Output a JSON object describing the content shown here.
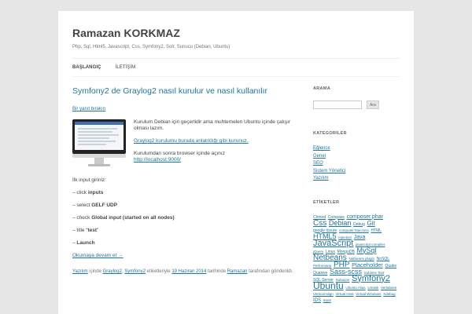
{
  "site": {
    "title": "Ramazan KORKMAZ",
    "description": "Php, Sql, Html5, Javascript, Css, Symfony2, Solr, Sunucu (Debian, Ubuntu)"
  },
  "nav": {
    "items": [
      {
        "label": "BAŞLANGIÇ"
      },
      {
        "label": "İLETİŞİM"
      }
    ]
  },
  "post": {
    "title": "Symfony2 de Graylog2 nasıl kurulur ve nasıl kullanılır",
    "comments_link": "Bir yanıt bırakın",
    "media_text": {
      "p1": "Kurulum Debian için geçerlidir ama muhtemelen Ubuntu içinde çalışır olması lazım.",
      "link": "Graylog2 kurulumu burada anlatıldığı gibi kurunuz.",
      "p3": "Kurulumdan sonra browser içinde açınız",
      "url": "http://localhost:9000/"
    },
    "body": {
      "intro": "İlk input giriniz:",
      "s1_prefix": "– click ",
      "s1_bold": "inputs",
      "s2_prefix": "– select ",
      "s2_bold": "GELF UDP",
      "s3_prefix": "– check ",
      "s3_bold": "Global input (started on all nodes)",
      "s4_prefix": "– title “",
      "s4_bold": "test",
      "s4_suffix": "”",
      "s5_prefix": "– ",
      "s5_bold": "Launch",
      "more": "Okumaya devam et →"
    },
    "meta": {
      "cat1": "Yazılım",
      "t1": " içinde ",
      "tag1": "Graylog2",
      "t2": ", ",
      "tag2": "Symfony2",
      "t3": " etiketleriyle ",
      "date": "19 Haziran 2014",
      "t4": " tarihinde ",
      "author": "Ramazan",
      "t5": " tarafından gönderildi."
    }
  },
  "sidebar": {
    "search": {
      "title": "ARAMA",
      "button": "Ara",
      "value": ""
    },
    "categories": {
      "title": "KATEGORİLER",
      "items": [
        {
          "label": "Eğlence"
        },
        {
          "label": "Genel"
        },
        {
          "label": "SEO"
        },
        {
          "label": "Sistem Yönetici"
        },
        {
          "label": "Yazılım"
        }
      ]
    },
    "tags": {
      "title": "ETİKETLER",
      "items": [
        {
          "label": "Chmod",
          "size": 5
        },
        {
          "label": "Compass",
          "size": 5
        },
        {
          "label": "composer.phar",
          "size": 7
        },
        {
          "label": "Css",
          "size": 10
        },
        {
          "label": "Debian",
          "size": 9
        },
        {
          "label": "Debug",
          "size": 5
        },
        {
          "label": "Git",
          "size": 8
        },
        {
          "label": "google tüsure",
          "size": 5
        },
        {
          "label": "computer htaccess",
          "size": 4.5
        },
        {
          "label": "HTML",
          "size": 5
        },
        {
          "label": "HTML5",
          "size": 9
        },
        {
          "label": "Injection",
          "size": 4.5
        },
        {
          "label": "Java",
          "size": 7
        },
        {
          "label": "JavaScript",
          "size": 11
        },
        {
          "label": "javascript compiler",
          "size": 4.5
        },
        {
          "label": "jQuery",
          "size": 4.5
        },
        {
          "label": "Linux",
          "size": 5
        },
        {
          "label": "MongoDB",
          "size": 5
        },
        {
          "label": "MySql",
          "size": 9
        },
        {
          "label": "Netbeans",
          "size": 10
        },
        {
          "label": "Netbeans plugin",
          "size": 4.5
        },
        {
          "label": "NoSQL",
          "size": 5
        },
        {
          "label": "Performans",
          "size": 4.5
        },
        {
          "label": "PHP",
          "size": 10
        },
        {
          "label": "Placeholder",
          "size": 7.5
        },
        {
          "label": "Quake",
          "size": 5
        },
        {
          "label": "Quakive",
          "size": 5
        },
        {
          "label": "Sass-scss",
          "size": 9
        },
        {
          "label": "Sublime Text",
          "size": 4.5
        },
        {
          "label": "SQL Server",
          "size": 5
        },
        {
          "label": "Subuşım",
          "size": 4.5
        },
        {
          "label": "Symfony2",
          "size": 11
        },
        {
          "label": "Ubuntu",
          "size": 12
        },
        {
          "label": "Ubuntu Alias",
          "size": 4.5
        },
        {
          "label": "Umask",
          "size": 4.5
        },
        {
          "label": "Vertabase",
          "size": 4.5
        },
        {
          "label": "Vertical-align",
          "size": 4.5
        },
        {
          "label": "Virtual Host",
          "size": 4.5
        },
        {
          "label": "Virtual Windows",
          "size": 4.5
        },
        {
          "label": "Xdebug",
          "size": 4.5
        },
        {
          "label": "IDS",
          "size": 6
        },
        {
          "label": "Input",
          "size": 4.5
        }
      ]
    }
  }
}
